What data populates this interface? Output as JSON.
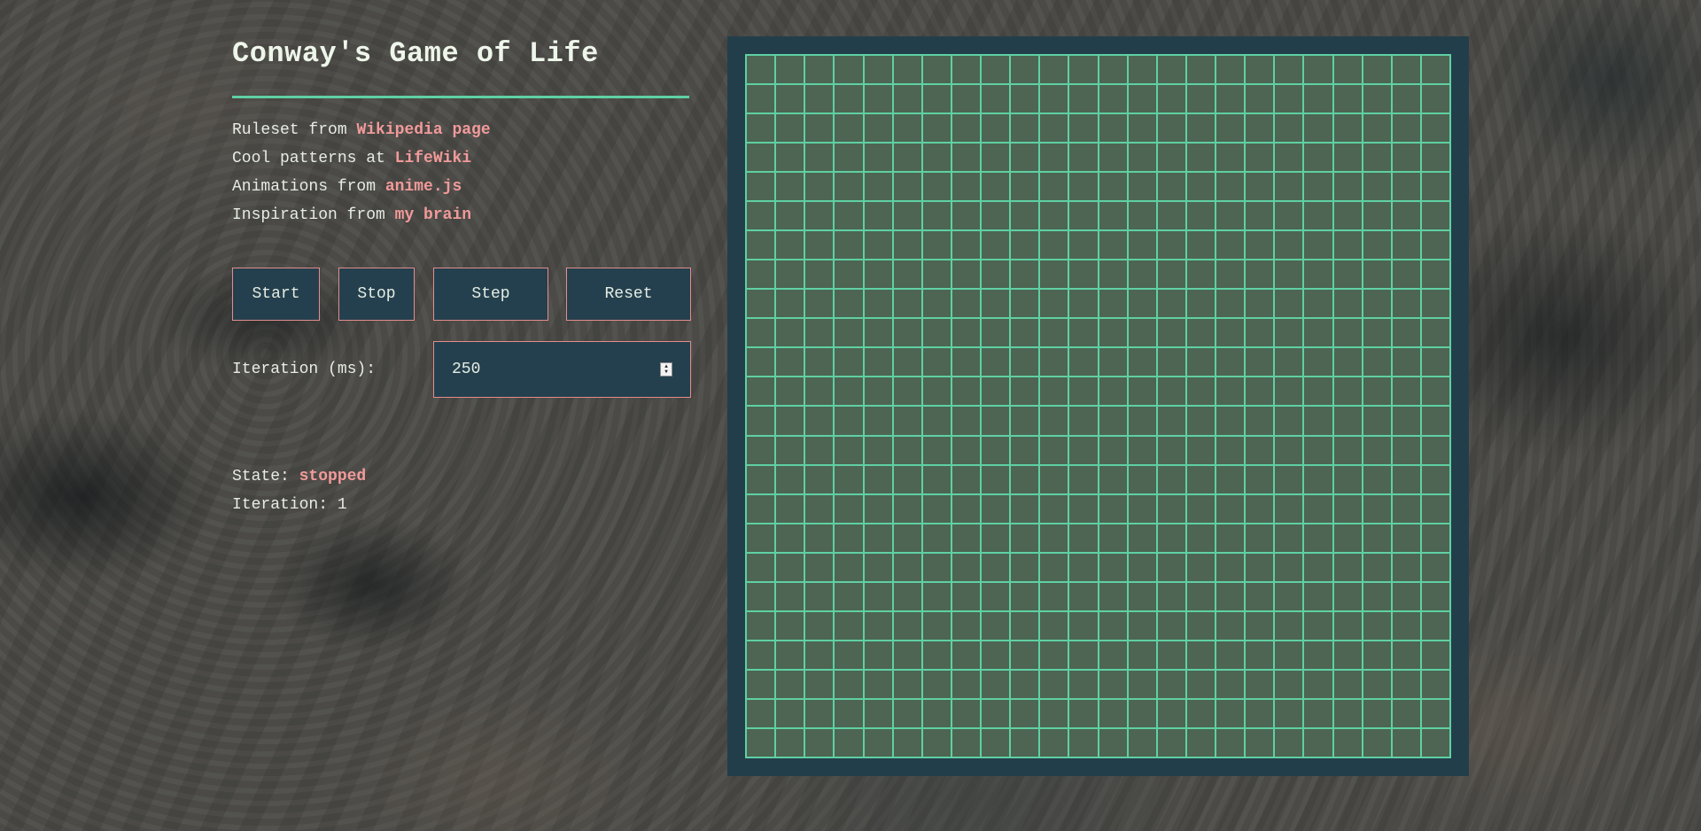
{
  "page": {
    "title": "Conway's Game of Life",
    "colors": {
      "accent": "#5fd0a3",
      "link": "#f29a9a",
      "panel": "#24404e",
      "button_border": "#e58c8c",
      "cell_dead": "#4d6552",
      "board_frame": "#233e4b"
    }
  },
  "credits": [
    {
      "prefix": "Ruleset from ",
      "link": "Wikipedia page"
    },
    {
      "prefix": "Cool patterns at ",
      "link": "LifeWiki"
    },
    {
      "prefix": "Animations from ",
      "link": "anime.js"
    },
    {
      "prefix": "Inspiration from ",
      "link": "my brain"
    }
  ],
  "controls": {
    "start_label": "Start",
    "stop_label": "Stop",
    "step_label": "Step",
    "reset_label": "Reset",
    "iteration_label": "Iteration (ms):",
    "iteration_value": "250",
    "spinner_icon": "spinner-arrows-icon"
  },
  "status": {
    "state_label": "State: ",
    "state_value": "stopped",
    "iteration_label": "Iteration: ",
    "iteration_value": "1"
  },
  "board": {
    "rows": 24,
    "cols": 24,
    "alive_cells": []
  }
}
